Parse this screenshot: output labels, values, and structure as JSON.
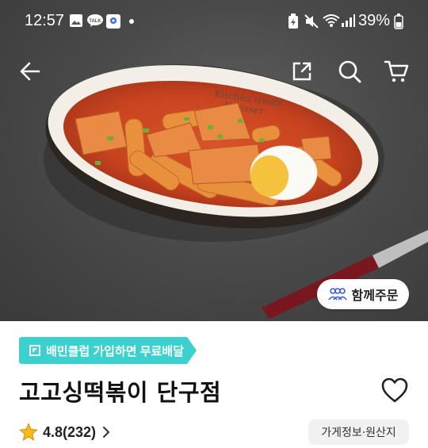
{
  "status_bar": {
    "time": "12:57",
    "battery_percent": "39%",
    "icons": [
      "gallery-icon",
      "kakaotalk-icon",
      "map-icon",
      "dot-icon",
      "battery-saver-icon",
      "mute-icon",
      "wifi-icon",
      "signal-icon",
      "battery-icon"
    ]
  },
  "nav": {
    "back_icon": "arrow-left-icon",
    "share_icon": "share-icon",
    "search_icon": "search-icon",
    "cart_icon": "cart-icon"
  },
  "hero": {
    "plate_text_line1": "Kitchen treats",
    "plate_text_line2": "Yonisser",
    "together_order_label": "함께주문"
  },
  "club_banner": {
    "label": "배민클럽 가입하면 무료배달",
    "color": "#3ad1cf"
  },
  "store": {
    "name": "고고싱떡볶이 단구점",
    "rating": "4.8(232)",
    "info_button": "가게정보·원산지"
  }
}
